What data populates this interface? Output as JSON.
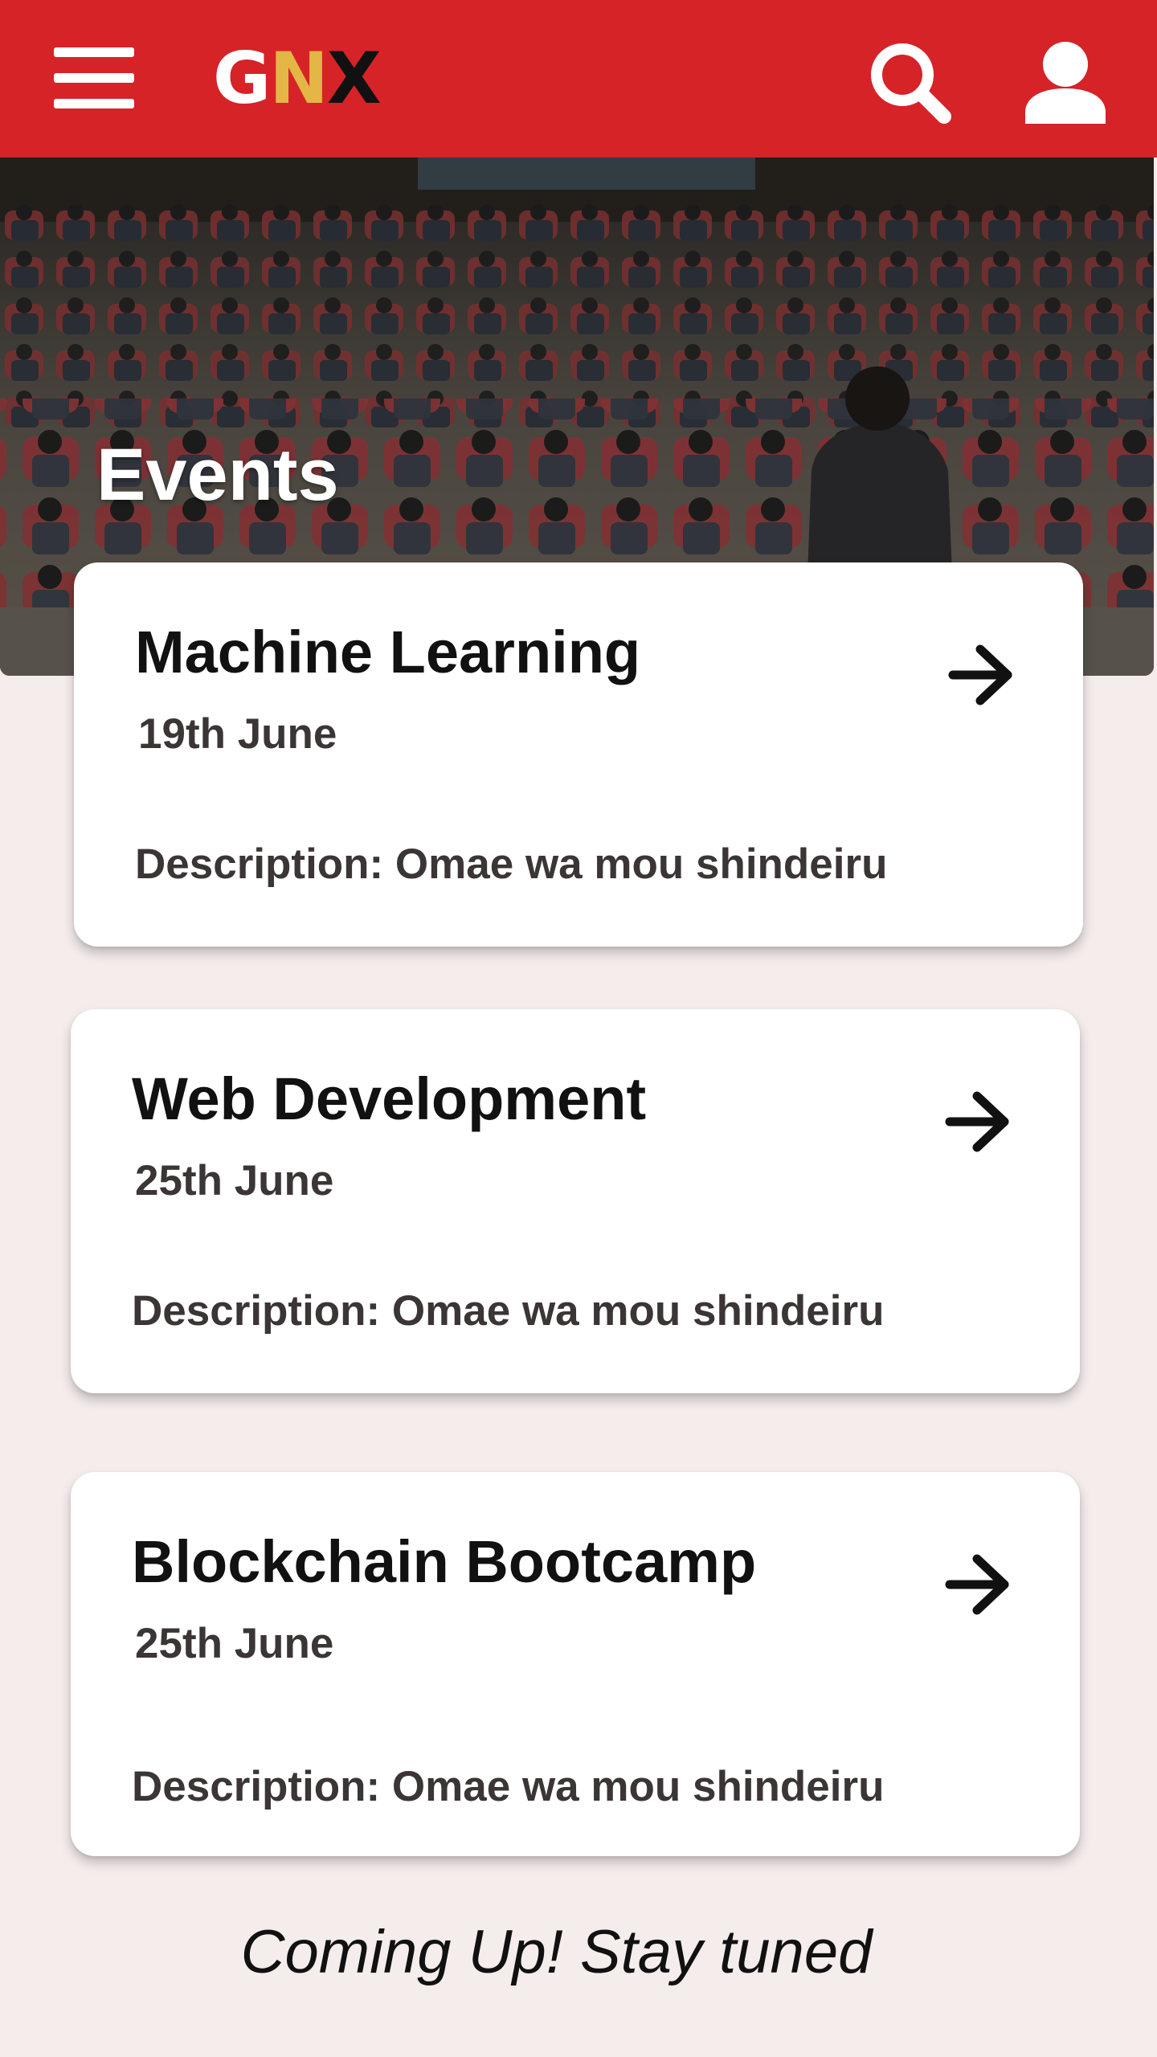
{
  "header": {
    "logo": {
      "letter1": "G",
      "letter2": "N",
      "letter3": "X"
    },
    "menu_icon": "hamburger-menu-icon",
    "search_icon": "search-icon",
    "account_icon": "account-icon",
    "bar_color": "#d62328"
  },
  "hero": {
    "title": "Events",
    "image": "conference audience photo"
  },
  "events": [
    {
      "title": "Machine Learning",
      "date": "19th June",
      "description": "Description: Omae wa mou shindeiru"
    },
    {
      "title": "Web Development",
      "date": "25th June",
      "description": "Description: Omae wa mou shindeiru"
    },
    {
      "title": "Blockchain Bootcamp",
      "date": "25th June",
      "description": "Description: Omae wa mou shindeiru"
    }
  ],
  "footer": {
    "note": "Coming Up! Stay tuned"
  }
}
